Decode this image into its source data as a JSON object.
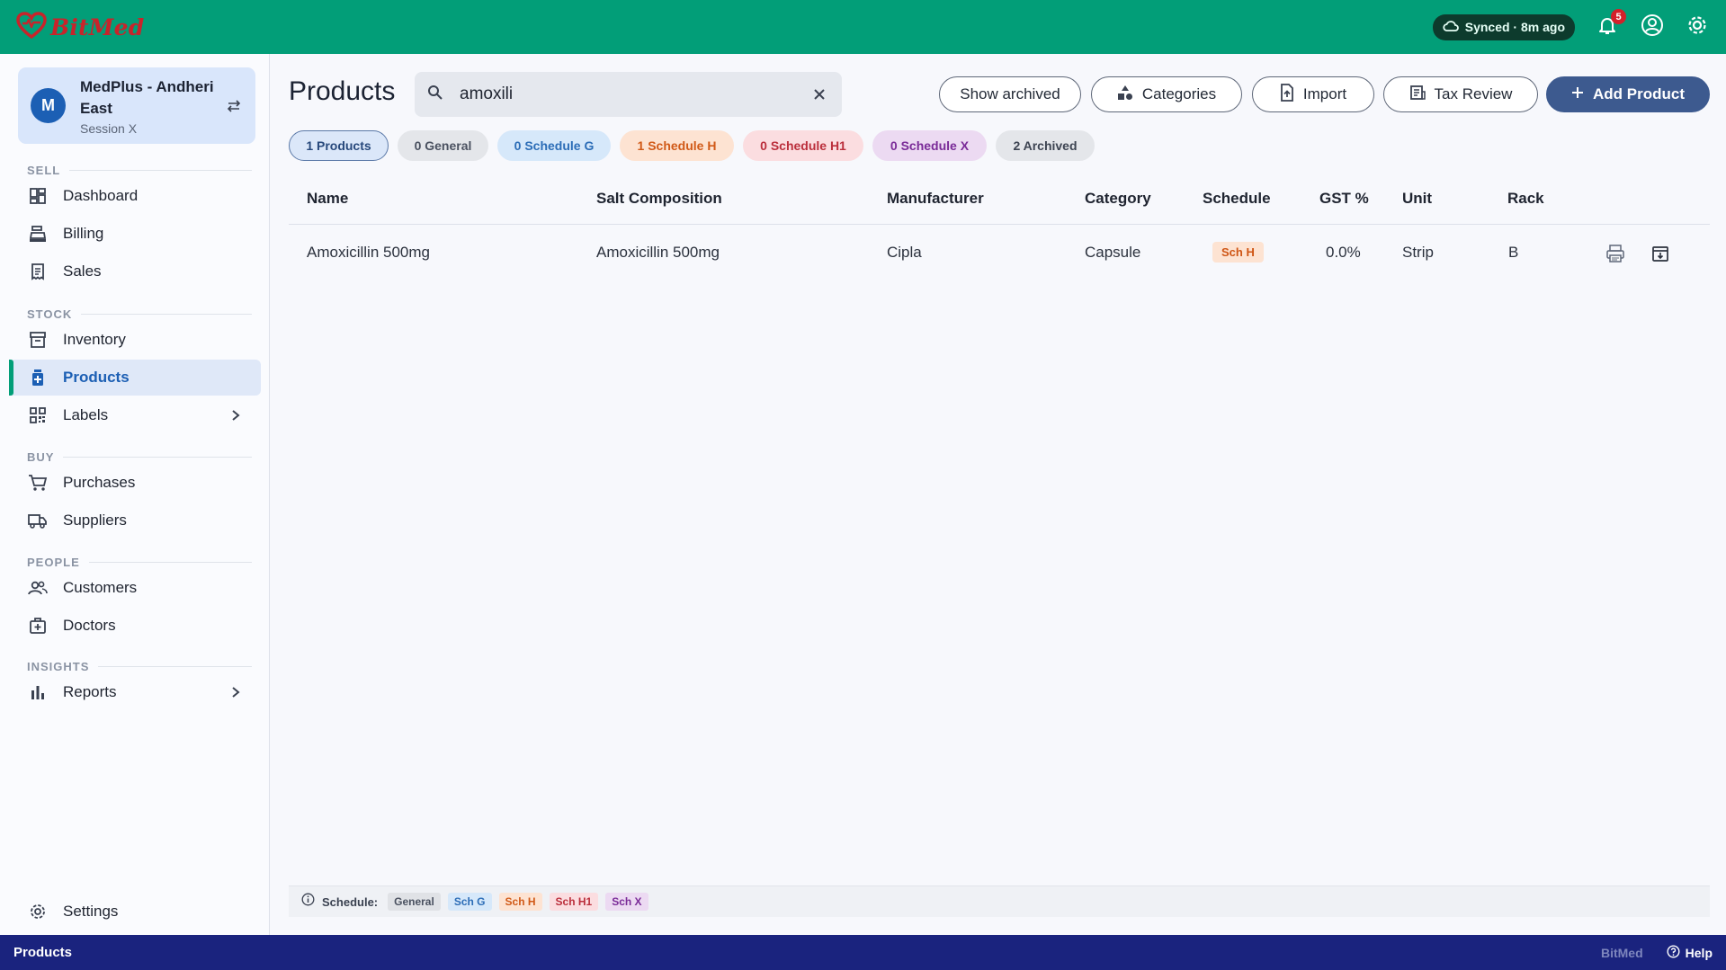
{
  "app": {
    "name": "BitMed"
  },
  "topbar": {
    "sync_status": "Synced · 8m ago",
    "notification_count": "5"
  },
  "store": {
    "avatar_initial": "M",
    "name": "MedPlus - Andheri East",
    "session": "Session X"
  },
  "sidebar": {
    "sections": {
      "sell": "SELL",
      "stock": "STOCK",
      "buy": "BUY",
      "people": "PEOPLE",
      "insights": "INSIGHTS"
    },
    "items": {
      "dashboard": "Dashboard",
      "billing": "Billing",
      "sales": "Sales",
      "inventory": "Inventory",
      "products": "Products",
      "labels": "Labels",
      "purchases": "Purchases",
      "suppliers": "Suppliers",
      "customers": "Customers",
      "doctors": "Doctors",
      "reports": "Reports",
      "settings": "Settings"
    },
    "active_item": "products"
  },
  "main": {
    "title": "Products",
    "search": {
      "value": "amoxili"
    },
    "buttons": {
      "show_archived": "Show archived",
      "categories": "Categories",
      "import": "Import",
      "tax_review": "Tax Review",
      "add_product": "Add Product"
    },
    "filters": [
      {
        "label": "1 Products",
        "selected": true
      },
      {
        "label": "0 General"
      },
      {
        "label": "0 Schedule G"
      },
      {
        "label": "1 Schedule H"
      },
      {
        "label": "0 Schedule H1"
      },
      {
        "label": "0 Schedule X"
      },
      {
        "label": "2 Archived"
      }
    ],
    "table": {
      "columns": [
        "Name",
        "Salt Composition",
        "Manufacturer",
        "Category",
        "Schedule",
        "GST %",
        "Unit",
        "Rack"
      ],
      "rows": [
        {
          "name": "Amoxicillin 500mg",
          "salt": "Amoxicillin 500mg",
          "manufacturer": "Cipla",
          "category": "Capsule",
          "schedule": "Sch H",
          "gst": "0.0%",
          "unit": "Strip",
          "rack": "B"
        }
      ]
    },
    "legend": {
      "label": "Schedule:",
      "tags": [
        "General",
        "Sch G",
        "Sch H",
        "Sch H1",
        "Sch X"
      ]
    }
  },
  "colors": {
    "topbar": "#029e78",
    "primary": "#3d5a8f",
    "statusbar": "#1a237e",
    "brand_red": "#c8242b"
  },
  "statusbar": {
    "page": "Products",
    "brand": "BitMed",
    "help": "Help"
  }
}
